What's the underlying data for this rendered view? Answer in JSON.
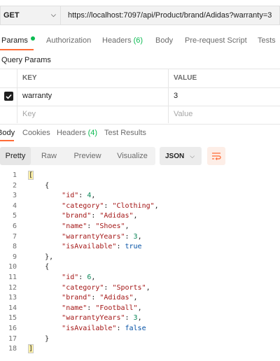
{
  "request": {
    "method": "GET",
    "url": "https://localhost:7097/api/Product/brand/Adidas?warranty=3"
  },
  "request_tabs": [
    {
      "label": "Params",
      "active": true
    },
    {
      "label": "Authorization"
    },
    {
      "label": "Headers",
      "count": "(6)"
    },
    {
      "label": "Body"
    },
    {
      "label": "Pre-request Script"
    },
    {
      "label": "Tests"
    }
  ],
  "query_params": {
    "title": "Query Params",
    "headers": {
      "key": "KEY",
      "value": "VALUE"
    },
    "rows": [
      {
        "key": "warranty",
        "value": "3",
        "checked": true
      }
    ],
    "placeholder": {
      "key": "Key",
      "value": "Value"
    }
  },
  "response_tabs": [
    {
      "label": "Body",
      "active": true
    },
    {
      "label": "Cookies"
    },
    {
      "label": "Headers",
      "count": "(4)"
    },
    {
      "label": "Test Results"
    }
  ],
  "viewer": {
    "modes": [
      "Pretty",
      "Raw",
      "Preview",
      "Visualize"
    ],
    "selected_mode": "Pretty",
    "format": "JSON",
    "wrap_icon": "wrap-lines-icon"
  },
  "response_items": [
    {
      "id": 4,
      "category": "Clothing",
      "brand": "Adidas",
      "name": "Shoes",
      "warrantyYears": 3,
      "isAvailable": true
    },
    {
      "id": 6,
      "category": "Sports",
      "brand": "Adidas",
      "name": "Football",
      "warrantyYears": 3,
      "isAvailable": false
    }
  ],
  "colors": {
    "accent": "#ff6c37",
    "status_dot": "#0cbb52",
    "json_key": "#a31515",
    "json_number": "#098658",
    "json_boolean": "#0451a5"
  }
}
